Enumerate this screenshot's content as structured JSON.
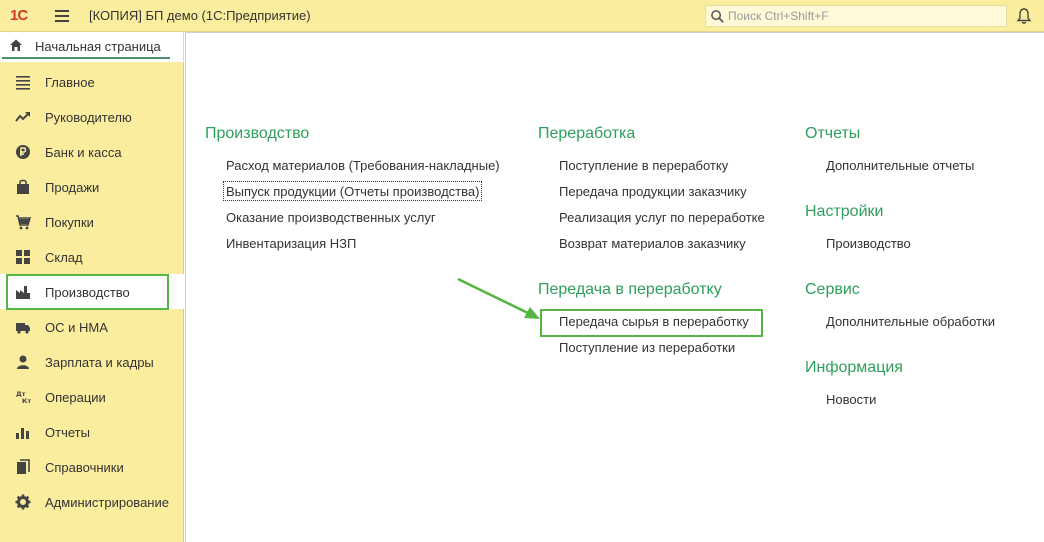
{
  "topbar": {
    "logo": "1С",
    "title": "[КОПИЯ] БП демо  (1С:Предприятие)",
    "search_placeholder": "Поиск Ctrl+Shift+F"
  },
  "tabs": {
    "home": "Начальная страница"
  },
  "sidebar": {
    "items": [
      {
        "label": "Главное",
        "icon": "list-icon"
      },
      {
        "label": "Руководителю",
        "icon": "trend-icon"
      },
      {
        "label": "Банк и касса",
        "icon": "ruble-icon"
      },
      {
        "label": "Продажи",
        "icon": "bag-icon"
      },
      {
        "label": "Покупки",
        "icon": "cart-icon"
      },
      {
        "label": "Склад",
        "icon": "grid-icon"
      },
      {
        "label": "Производство",
        "icon": "factory-icon",
        "active": true
      },
      {
        "label": "ОС и НМА",
        "icon": "truck-icon"
      },
      {
        "label": "Зарплата и кадры",
        "icon": "person-icon"
      },
      {
        "label": "Операции",
        "icon": "dt-kt-icon"
      },
      {
        "label": "Отчеты",
        "icon": "bar-chart-icon"
      },
      {
        "label": "Справочники",
        "icon": "books-icon"
      },
      {
        "label": "Администрирование",
        "icon": "gear-icon"
      }
    ]
  },
  "sections": {
    "production": {
      "title": "Производство",
      "links": [
        "Расход материалов (Требования-накладные)",
        "Выпуск продукции (Отчеты производства)",
        "Оказание производственных услуг",
        "Инвентаризация НЗП"
      ]
    },
    "processing": {
      "title": "Переработка",
      "links": [
        "Поступление в переработку",
        "Передача продукции заказчику",
        "Реализация услуг по переработке",
        "Возврат материалов заказчику"
      ]
    },
    "outsourcing": {
      "title": "Передача в переработку",
      "links": [
        "Передача сырья в переработку",
        "Поступление из переработки"
      ]
    },
    "reports": {
      "title": "Отчеты",
      "links": [
        "Дополнительные отчеты"
      ]
    },
    "settings": {
      "title": "Настройки",
      "links": [
        "Производство"
      ]
    },
    "service": {
      "title": "Сервис",
      "links": [
        "Дополнительные обработки"
      ]
    },
    "info": {
      "title": "Информация",
      "links": [
        "Новости"
      ]
    }
  },
  "colors": {
    "sidebar_bg": "#fbed9e",
    "section_title": "#2e9e5b",
    "highlight": "#56b443",
    "logo": "#d5372c"
  }
}
